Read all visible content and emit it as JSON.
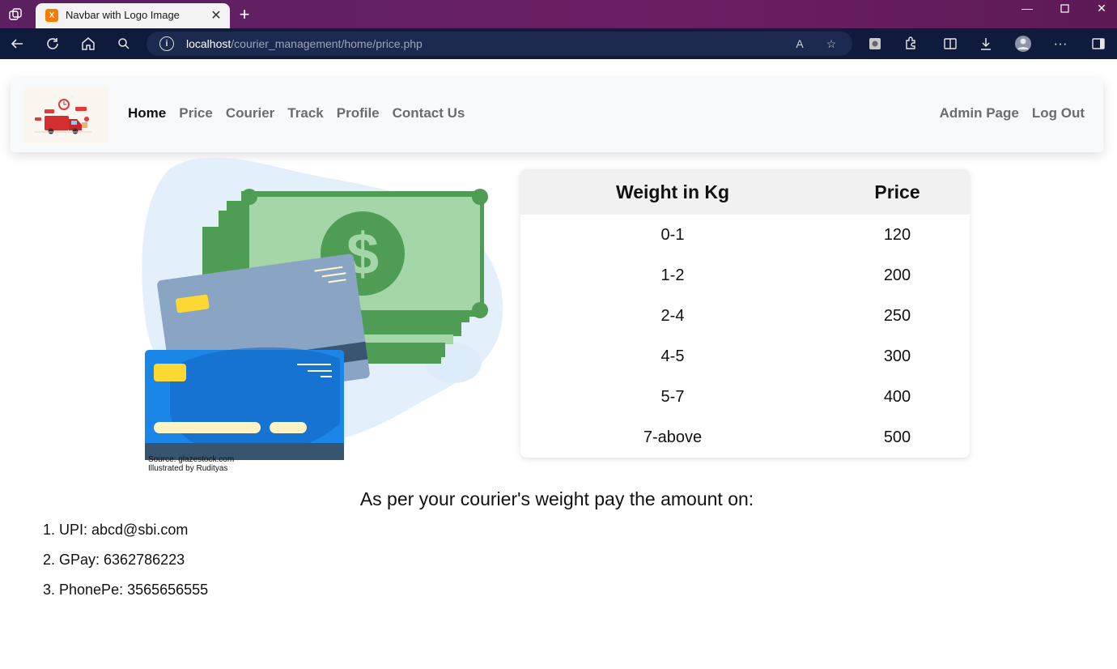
{
  "browser": {
    "tab_title": "Navbar with Logo Image",
    "tab_favicon": "xampp-icon",
    "url_host": "localhost",
    "url_path": "/courier_management/home/price.php"
  },
  "nav": {
    "links": [
      "Home",
      "Price",
      "Courier",
      "Track",
      "Profile",
      "Contact Us"
    ],
    "right_links": [
      "Admin Page",
      "Log Out"
    ]
  },
  "illustration": {
    "credit_line1": "Source: glazestock.com",
    "credit_line2": "Illustrated by Rudityas"
  },
  "price_table": {
    "headers": [
      "Weight in Kg",
      "Price"
    ],
    "rows": [
      [
        "0-1",
        "120"
      ],
      [
        "1-2",
        "200"
      ],
      [
        "2-4",
        "250"
      ],
      [
        "4-5",
        "300"
      ],
      [
        "5-7",
        "400"
      ],
      [
        "7-above",
        "500"
      ]
    ]
  },
  "payment": {
    "heading": "As per your courier's weight pay the amount on:",
    "items": [
      "1. UPI: abcd@sbi.com",
      "2. GPay: 6362786223",
      "3. PhonePe: 3565656555"
    ]
  },
  "colors": {
    "tabstrip": "#5a2060",
    "toolbar": "#0f1b3d",
    "navbar_bg": "#f8f9fa",
    "money_green": "#4f9d55",
    "card_blue": "#1a86e8"
  }
}
